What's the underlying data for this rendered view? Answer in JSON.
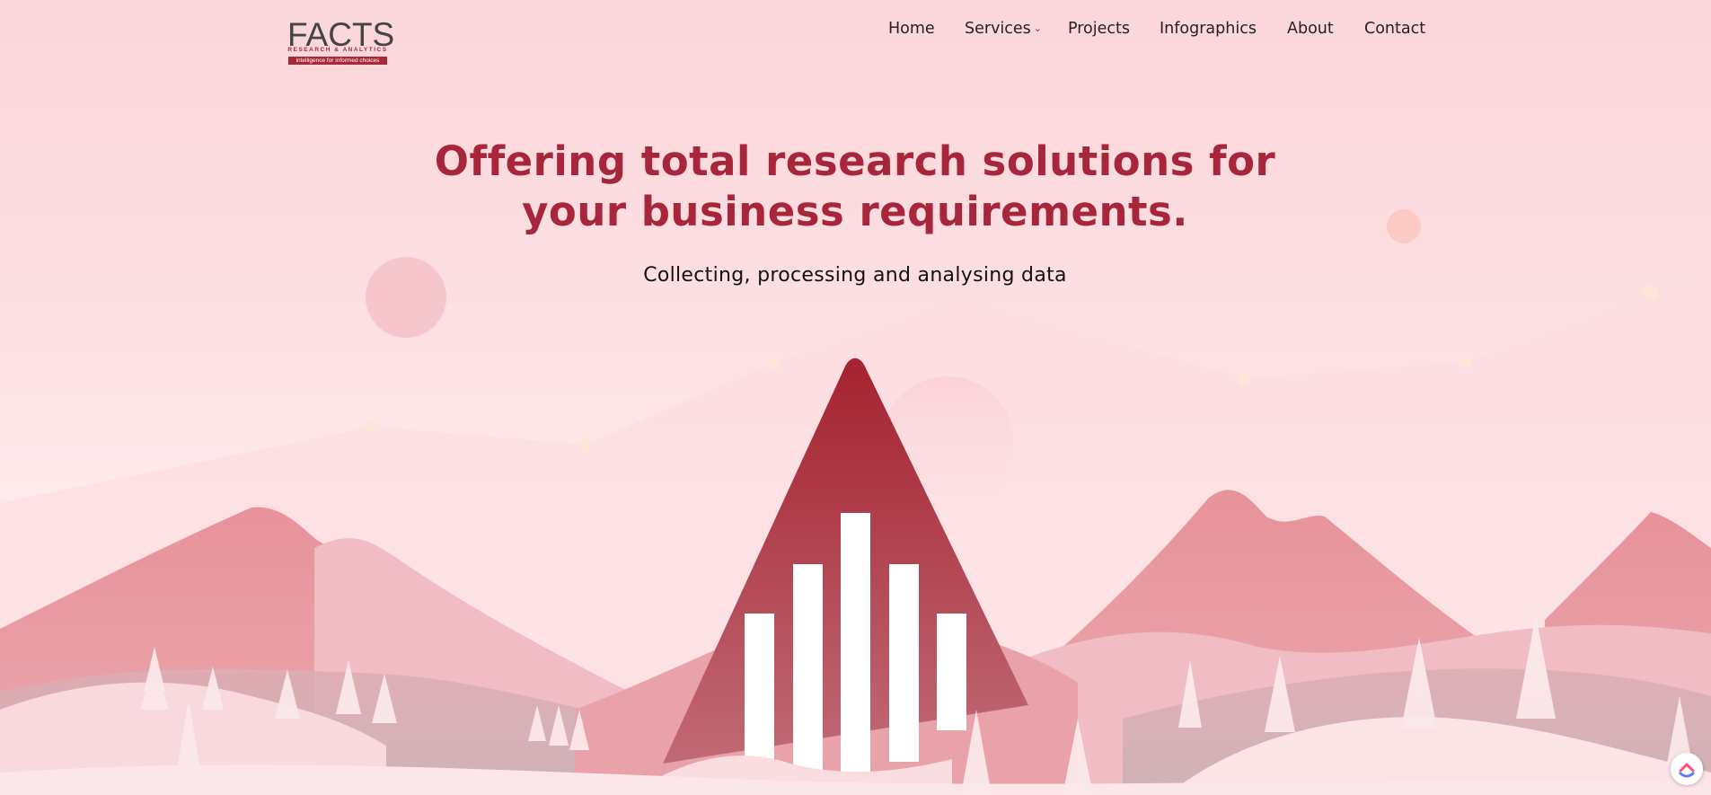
{
  "logo": {
    "wordmark": "FACTS",
    "subtitle": "RESEARCH & ANALYTICS",
    "tagline": "intelligence for informed choices"
  },
  "nav": {
    "items": [
      {
        "label": "Home"
      },
      {
        "label": "Services",
        "has_dropdown": true
      },
      {
        "label": "Projects"
      },
      {
        "label": "Infographics"
      },
      {
        "label": "About"
      },
      {
        "label": "Contact"
      }
    ]
  },
  "hero": {
    "headline_line1": "Offering total research solutions for",
    "headline_line2": "your business requirements.",
    "subheadline": "Collecting, processing and analysing data"
  },
  "colors": {
    "brand": "#a8263a",
    "background": "#fbd6da",
    "mountain_dark": "#e8959d",
    "mountain_light": "#f1b9c0"
  },
  "icons": {
    "chat_widget": "support-chat-icon",
    "dropdown": "chevron-down-icon"
  }
}
